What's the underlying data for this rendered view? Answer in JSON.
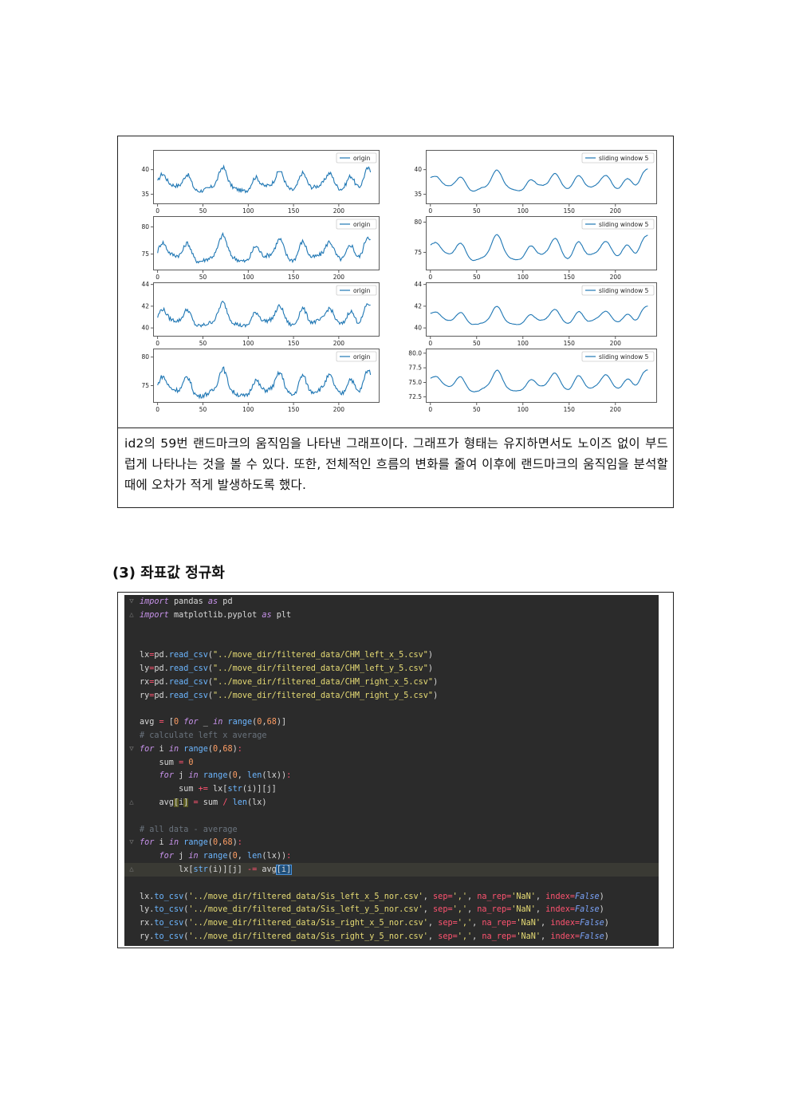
{
  "figure": {
    "caption": "id2의 59번 랜드마크의 움직임을 나타낸 그래프이다. 그래프가 형태는 유지하면서도 노이즈 없이 부드럽게 나타나는 것을 볼 수 있다. 또한, 전체적인 흐름의 변화를 줄여 이후에 랜드마크의 움직임을 분석할 때에 오차가 적게 발생하도록 했다."
  },
  "chart_data": [
    {
      "type": "line",
      "legend": "origin",
      "xticks": [
        0,
        50,
        100,
        150,
        200
      ],
      "yticks": [
        35,
        40
      ],
      "ylim": [
        33,
        44
      ],
      "xlim": [
        -5,
        245
      ],
      "line_color": "#1f77b4",
      "smooth": false,
      "base": 37.5,
      "amp": 4
    },
    {
      "type": "line",
      "legend": "sliding window 5",
      "xticks": [
        0,
        50,
        100,
        150,
        200
      ],
      "yticks": [
        35,
        40
      ],
      "ylim": [
        33,
        44
      ],
      "xlim": [
        -5,
        245
      ],
      "line_color": "#1f77b4",
      "smooth": true,
      "base": 37.5,
      "amp": 4
    },
    {
      "type": "line",
      "legend": "origin",
      "xticks": [
        0,
        50,
        100,
        150,
        200
      ],
      "yticks": [
        75,
        80
      ],
      "ylim": [
        72,
        82
      ],
      "xlim": [
        -5,
        245
      ],
      "line_color": "#1f77b4",
      "smooth": false,
      "base": 75.5,
      "amp": 4
    },
    {
      "type": "line",
      "legend": "sliding window 5",
      "xticks": [
        0,
        50,
        100,
        150,
        200
      ],
      "yticks": [
        75,
        80
      ],
      "ylim": [
        72,
        81
      ],
      "xlim": [
        -5,
        245
      ],
      "line_color": "#1f77b4",
      "smooth": true,
      "base": 75.5,
      "amp": 4
    },
    {
      "type": "line",
      "legend": "origin",
      "xticks": [
        0,
        50,
        100,
        150,
        200
      ],
      "yticks": [
        40,
        42,
        44
      ],
      "ylim": [
        39.2,
        44.2
      ],
      "xlim": [
        -5,
        245
      ],
      "line_color": "#1f77b4",
      "smooth": false,
      "base": 41,
      "amp": 1.8
    },
    {
      "type": "line",
      "legend": "sliding window 5",
      "xticks": [
        0,
        50,
        100,
        150,
        200
      ],
      "yticks": [
        40,
        42,
        44
      ],
      "ylim": [
        39.2,
        44.2
      ],
      "xlim": [
        -5,
        245
      ],
      "line_color": "#1f77b4",
      "smooth": true,
      "base": 41,
      "amp": 1.6
    },
    {
      "type": "line",
      "legend": "origin",
      "xticks": [
        0,
        50,
        100,
        150,
        200
      ],
      "yticks": [
        75,
        80
      ],
      "ylim": [
        72,
        81.5
      ],
      "xlim": [
        -5,
        245
      ],
      "line_color": "#1f77b4",
      "smooth": false,
      "base": 75,
      "amp": 4
    },
    {
      "type": "line",
      "legend": "sliding window 5",
      "xticks": [
        0,
        50,
        100,
        150,
        200
      ],
      "yticks": [
        72.5,
        75.0,
        77.5,
        80.0
      ],
      "ylim": [
        71.5,
        80.8
      ],
      "xlim": [
        -5,
        245
      ],
      "line_color": "#1f77b4",
      "smooth": true,
      "base": 75,
      "amp": 3.5
    }
  ],
  "section": {
    "title": "(3) 좌표값 정규화"
  },
  "code": {
    "lines": [
      {
        "n": 1,
        "html": "<span class='kw'>import</span> pandas <span class='kw'>as</span> pd"
      },
      {
        "n": 2,
        "html": "<span class='kw'>import</span> matplotlib.pyplot <span class='kw'>as</span> plt"
      },
      {
        "n": 3,
        "html": ""
      },
      {
        "n": 4,
        "html": ""
      },
      {
        "n": 5,
        "html": "lx<span class='op'>=</span>pd.<span class='fn'>read_csv</span>(<span class='str'>\"../move_dir/filtered_data/CHM_left_x_5.csv\"</span>)"
      },
      {
        "n": 6,
        "html": "ly<span class='op'>=</span>pd.<span class='fn'>read_csv</span>(<span class='str'>\"../move_dir/filtered_data/CHM_left_y_5.csv\"</span>)"
      },
      {
        "n": 7,
        "html": "rx<span class='op'>=</span>pd.<span class='fn'>read_csv</span>(<span class='str'>\"../move_dir/filtered_data/CHM_right_x_5.csv\"</span>)"
      },
      {
        "n": 8,
        "html": "ry<span class='op'>=</span>pd.<span class='fn'>read_csv</span>(<span class='str'>\"../move_dir/filtered_data/CHM_right_y_5.csv\"</span>)"
      },
      {
        "n": 9,
        "html": ""
      },
      {
        "n": 10,
        "html": "avg <span class='op'>=</span> [<span class='num'>0</span> <span class='kw'>for</span> _ <span class='kw'>in</span> <span class='fn'>range</span>(<span class='num'>0</span>,<span class='num'>68</span>)]"
      },
      {
        "n": 11,
        "html": "<span class='cm'># calculate left x average</span>"
      },
      {
        "n": 12,
        "html": "<span class='kw'>for</span> i <span class='kw'>in</span> <span class='fn'>range</span>(<span class='num'>0</span>,<span class='num'>68</span>)<span class='op'>:</span>"
      },
      {
        "n": 13,
        "html": "    sum <span class='op'>=</span> <span class='num'>0</span>"
      },
      {
        "n": 14,
        "html": "    <span class='kw'>for</span> j <span class='kw'>in</span> <span class='fn'>range</span>(<span class='num'>0</span>, <span class='fn'>len</span>(lx))<span class='op'>:</span>"
      },
      {
        "n": 15,
        "html": "        sum <span class='op'>+=</span> lx[<span class='fn'>str</span>(i)][j]"
      },
      {
        "n": 16,
        "html": "    avg<span class='sel2'>[</span>i<span class='sel2'>]</span> <span class='op'>=</span> sum <span class='op'>/</span> <span class='fn'>len</span>(lx)"
      },
      {
        "n": 17,
        "html": ""
      },
      {
        "n": 18,
        "html": "<span class='cm'># all data - average</span>"
      },
      {
        "n": 19,
        "html": "<span class='kw'>for</span> i <span class='kw'>in</span> <span class='fn'>range</span>(<span class='num'>0</span>,<span class='num'>68</span>)<span class='op'>:</span>"
      },
      {
        "n": 20,
        "html": "    <span class='kw'>for</span> j <span class='kw'>in</span> <span class='fn'>range</span>(<span class='num'>0</span>, <span class='fn'>len</span>(lx))<span class='op'>:</span>"
      },
      {
        "n": 21,
        "html": "        lx[<span class='fn'>str</span>(i)][j] <span class='op'>-=</span> avg<span class='sel'>[i]</span>",
        "hl": true
      },
      {
        "n": 22,
        "html": ""
      },
      {
        "n": 23,
        "html": "lx.<span class='fn'>to_csv</span>(<span class='str'>'../move_dir/filtered_data/Sis_left_x_5_nor.csv'</span>, <span class='op'>sep=</span><span class='str'>','</span>, <span class='op'>na_rep=</span><span class='str'>'NaN'</span>, <span class='op'>index=</span><span class='kw2'>False</span>)"
      },
      {
        "n": 24,
        "html": "ly.<span class='fn'>to_csv</span>(<span class='str'>'../move_dir/filtered_data/Sis_left_y_5_nor.csv'</span>, <span class='op'>sep=</span><span class='str'>','</span>, <span class='op'>na_rep=</span><span class='str'>'NaN'</span>, <span class='op'>index=</span><span class='kw2'>False</span>)"
      },
      {
        "n": 25,
        "html": "rx.<span class='fn'>to_csv</span>(<span class='str'>'../move_dir/filtered_data/Sis_right_x_5_nor.csv'</span>, <span class='op'>sep=</span><span class='str'>','</span>, <span class='op'>na_rep=</span><span class='str'>'NaN'</span>, <span class='op'>index=</span><span class='kw2'>False</span>)"
      },
      {
        "n": 26,
        "html": "ry.<span class='fn'>to_csv</span>(<span class='str'>'../move_dir/filtered_data/Sis_right_y_5_nor.csv'</span>, <span class='op'>sep=</span><span class='str'>','</span>, <span class='op'>na_rep=</span><span class='str'>'NaN'</span>, <span class='op'>index=</span><span class='kw2'>False</span>)"
      }
    ]
  }
}
